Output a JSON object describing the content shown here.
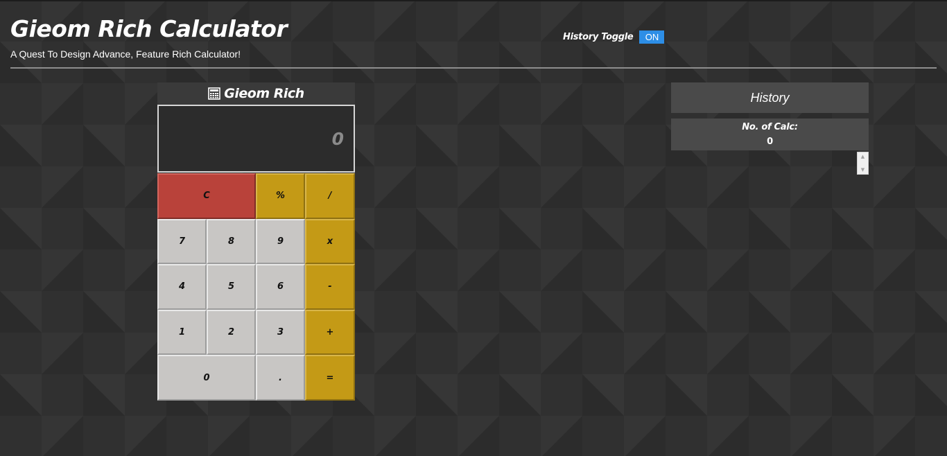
{
  "header": {
    "title": "Gieom Rich Calculator",
    "subtitle": "A Quest To Design Advance, Feature Rich Calculator!"
  },
  "history_toggle": {
    "label": "History Toggle",
    "state": "ON",
    "color": "#2d8ee6"
  },
  "calculator": {
    "title": "Gieom Rich",
    "title_icon": "calculator-icon",
    "display_value": "0",
    "keys": {
      "clear": "C",
      "percent": "%",
      "divide": "/",
      "seven": "7",
      "eight": "8",
      "nine": "9",
      "multiply": "x",
      "four": "4",
      "five": "5",
      "six": "6",
      "minus": "-",
      "one": "1",
      "two": "2",
      "three": "3",
      "plus": "+",
      "zero": "0",
      "dot": ".",
      "equals": "="
    },
    "colors": {
      "clear": "#b9423a",
      "operator": "#c49a16",
      "number": "#c8c6c4"
    }
  },
  "history": {
    "title": "History",
    "count_label": "No. of Calc:",
    "count_value": "0",
    "scroll_up_icon": "chevron-up-icon",
    "scroll_down_icon": "chevron-down-icon"
  }
}
